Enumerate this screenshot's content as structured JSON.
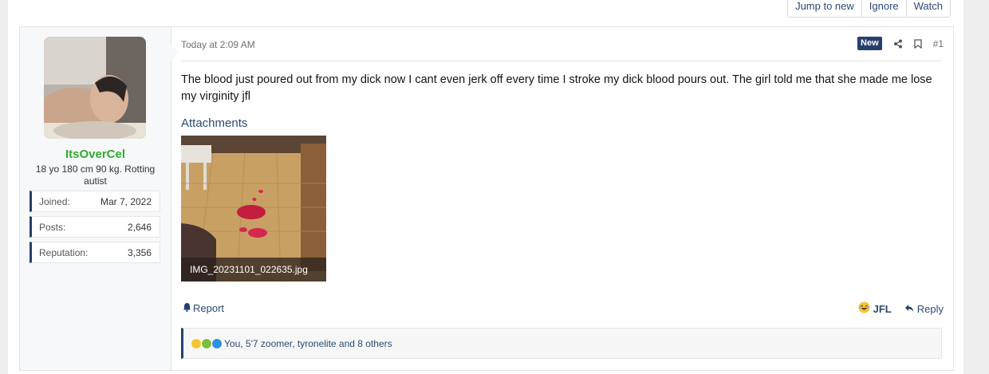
{
  "topbar": {
    "jump_label": "Jump to new",
    "ignore_label": "Ignore",
    "watch_label": "Watch"
  },
  "user": {
    "username": "ItsOverCel",
    "title": "18 yo 180 cm 90 kg. Rotting autist",
    "stats": [
      {
        "key": "Joined:",
        "value": "Mar 7, 2022"
      },
      {
        "key": "Posts:",
        "value": "2,646"
      },
      {
        "key": "Reputation:",
        "value": "3,356"
      }
    ],
    "username_color": "#2eab33"
  },
  "post": {
    "date": "Today at 2:09 AM",
    "new_badge": "New",
    "number": "#1",
    "body": "The blood just poured out from my dick now I cant even jerk off every time I stroke my dick blood pours out. The girl told me that she made me lose my virginity jfl",
    "attachments_title": "Attachments",
    "attachment_filename": "IMG_20231101_022635.jpg"
  },
  "actions": {
    "report_label": "Report",
    "jfl_label": "JFL",
    "reply_label": "Reply"
  },
  "reactions": {
    "summary": "You, 5'7 zoomer, tyronelite and 8 others"
  },
  "colors": {
    "accent": "#263f6b",
    "link": "#2b4a73"
  }
}
